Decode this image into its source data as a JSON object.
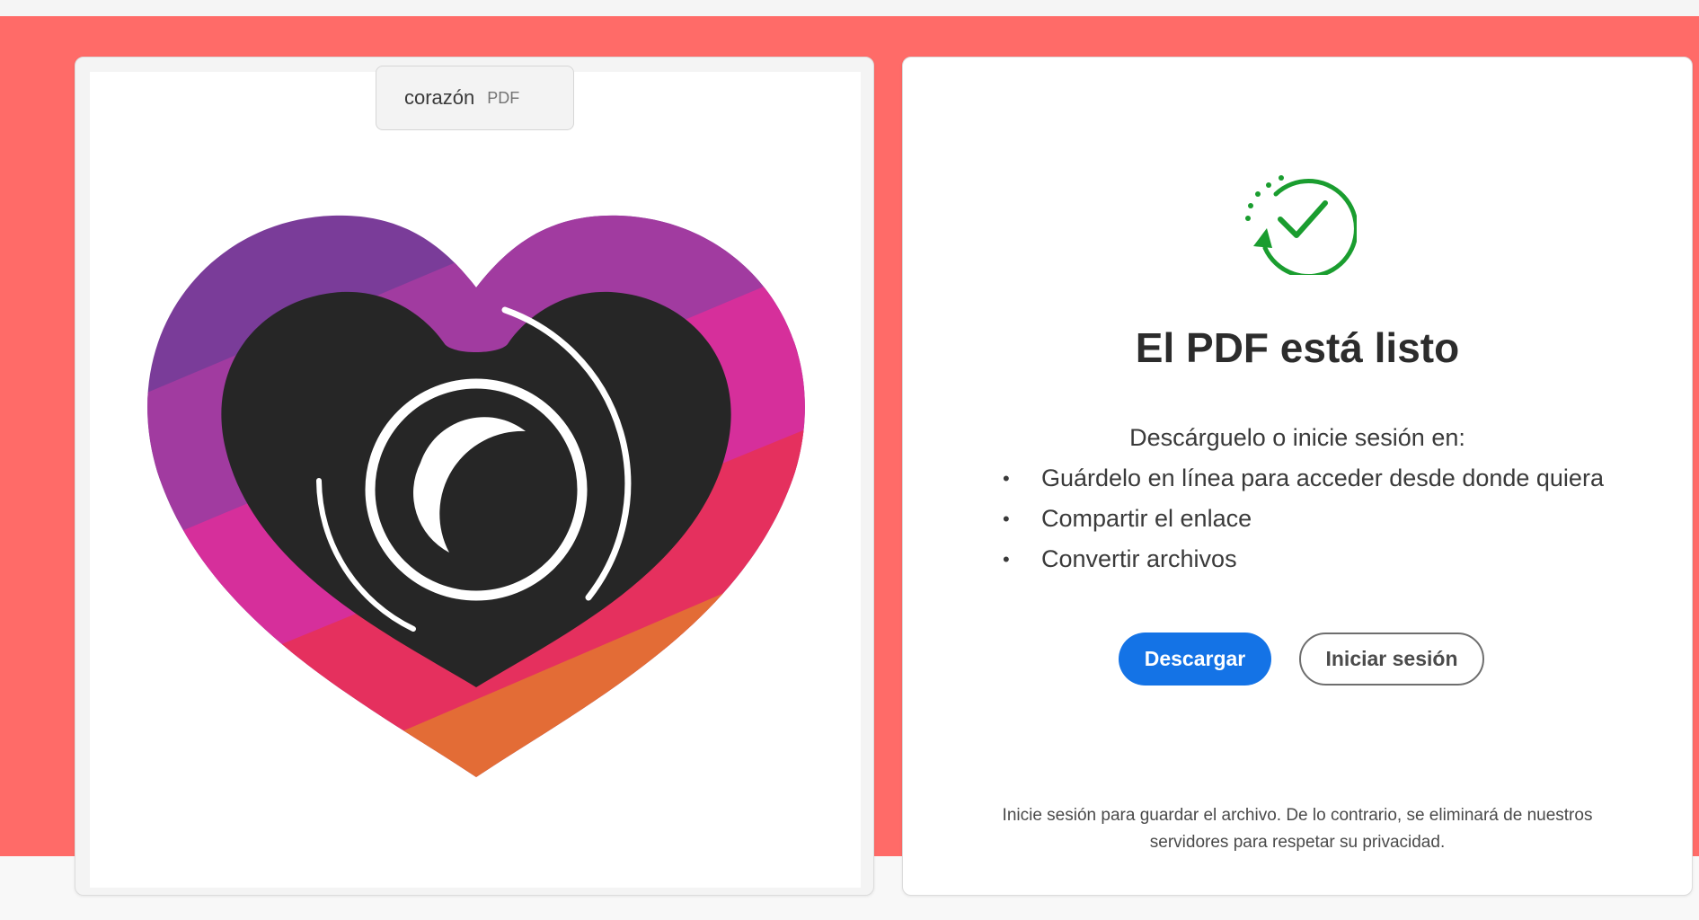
{
  "file": {
    "name": "corazón",
    "type": "PDF"
  },
  "preview": {
    "image_icon": "heart-camera-image"
  },
  "result": {
    "status_icon": "check-circle-icon",
    "title": "El PDF está listo",
    "intro": "Descárguelo o inicie sesión en:",
    "benefits": [
      "Guárdelo en línea para acceder desde donde quiera",
      "Compartir el enlace",
      "Convertir archivos"
    ],
    "bullet": "•",
    "download_label": "Descargar",
    "signin_label": "Iniciar sesión",
    "privacy_note": "Inicie sesión para guardar el archivo. De lo contrario, se eliminará de nuestros servidores para respetar su privacidad."
  },
  "colors": {
    "hero_background": "#ff6b68",
    "primary_button": "#1473e6",
    "success_green": "#1a9d2f",
    "heart_purple": "#7a3c99",
    "heart_magenta": "#d62f9b",
    "heart_red": "#e5305e",
    "heart_orange": "#e36c36"
  }
}
